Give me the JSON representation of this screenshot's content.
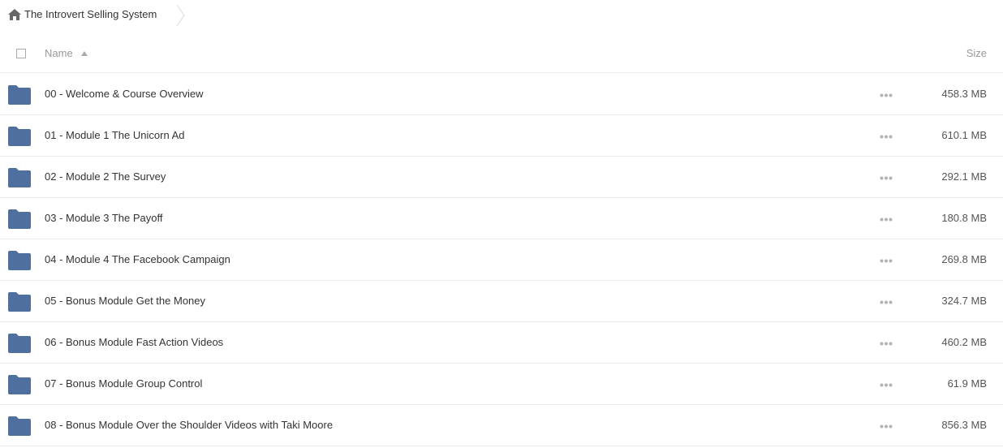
{
  "breadcrumb": {
    "home_icon": "home-icon",
    "current": "The Introvert Selling System"
  },
  "header": {
    "name_label": "Name",
    "size_label": "Size",
    "sort_direction": "ascending"
  },
  "colors": {
    "folder": "#4f6f9e",
    "text": "#333333",
    "muted": "#999999",
    "divider": "#ebebeb"
  },
  "rows": [
    {
      "name": "00 - Welcome & Course Overview",
      "size": "458.3 MB",
      "icon": "folder-icon"
    },
    {
      "name": "01 - Module 1 The Unicorn Ad",
      "size": "610.1 MB",
      "icon": "folder-icon"
    },
    {
      "name": "02 - Module 2 The Survey",
      "size": "292.1 MB",
      "icon": "folder-icon"
    },
    {
      "name": "03 - Module 3 The Payoff",
      "size": "180.8 MB",
      "icon": "folder-icon"
    },
    {
      "name": "04 - Module 4 The Facebook Campaign",
      "size": "269.8 MB",
      "icon": "folder-icon"
    },
    {
      "name": "05 - Bonus Module Get the Money",
      "size": "324.7 MB",
      "icon": "folder-icon"
    },
    {
      "name": "06 - Bonus Module Fast Action Videos",
      "size": "460.2 MB",
      "icon": "folder-icon"
    },
    {
      "name": "07 - Bonus Module Group Control",
      "size": "61.9 MB",
      "icon": "folder-icon"
    },
    {
      "name": "08 - Bonus Module Over the Shoulder Videos with Taki Moore",
      "size": "856.3 MB",
      "icon": "folder-icon"
    }
  ]
}
